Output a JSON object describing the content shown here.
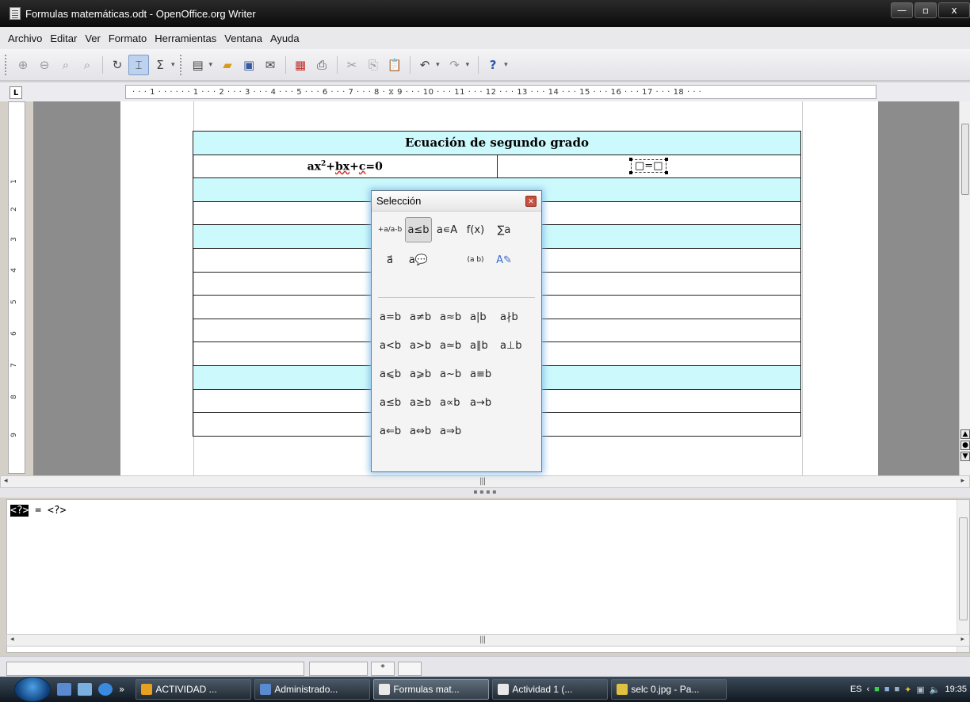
{
  "window": {
    "title": "Formulas matemáticas.odt - OpenOffice.org Writer",
    "min": "—",
    "max": "▫",
    "close": "x"
  },
  "menu": [
    "Archivo",
    "Editar",
    "Ver",
    "Formato",
    "Herramientas",
    "Ventana",
    "Ayuda"
  ],
  "ruler": {
    "tab_stop_label": "L",
    "h_text": "· · · 1 · · ·   · · · 1 · · · 2 · · · 3 · · · 4 · · · 5 · · · 6 · · · 7 · · · 8 · ⧖ 9 · · · 10 · · · 11 · · · 12 · · · 13 · · · 14 · · · 15 · · · 16 · · · 17 · · · 18 · · ·",
    "v_marks": [
      "1",
      "2",
      "3",
      "4",
      "5",
      "6",
      "7",
      "8",
      "9"
    ]
  },
  "document": {
    "table_heading": "Ecuación de segundo grado",
    "formula_pre": "ax",
    "formula_sup": "2",
    "formula_b": "bx",
    "formula_plus": "+",
    "formula_c": "c",
    "formula_end": "=0",
    "placeholder_formula": "□=□"
  },
  "dialog": {
    "title": "Selección",
    "categories": [
      "+a/a-b",
      "a≤b",
      "a∊A",
      "f(x)",
      "∑a",
      "a⃗",
      "a💬",
      "(a b)",
      "A✎"
    ],
    "symbols": [
      [
        "a=b",
        "a≠b",
        "a≈b",
        "a|b",
        "a∤b"
      ],
      [
        "a<b",
        "a>b",
        "a≃b",
        "a∥b",
        "a⊥b"
      ],
      [
        "a⩽b",
        "a⩾b",
        "a~b",
        "a≡b"
      ],
      [
        "a≤b",
        "a≥b",
        "a∝b",
        "a→b"
      ],
      [
        "a⇐b",
        "a⇔b",
        "a⇒b"
      ]
    ]
  },
  "command": {
    "selected": "<?>",
    "rest": " = <?>"
  },
  "status": {
    "star": "*"
  },
  "taskbar": {
    "tasks": [
      {
        "label": "ACTIVIDAD ...",
        "color": "#e8a020"
      },
      {
        "label": "Administrado...",
        "color": "#5a8ad0"
      },
      {
        "label": "Formulas mat...",
        "color": "#e8e8e8"
      },
      {
        "label": "Actividad 1 (...",
        "color": "#e8e8e8"
      },
      {
        "label": "selc 0.jpg - Pa...",
        "color": "#e0c040"
      }
    ],
    "chevron": "»",
    "lang": "ES",
    "clock": "19:35"
  }
}
